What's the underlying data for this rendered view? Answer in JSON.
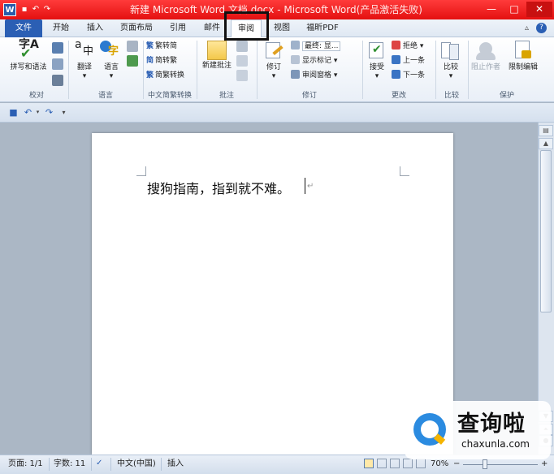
{
  "window": {
    "title": "新建 Microsoft Word 文档.docx  -  Microsoft Word(产品激活失败)",
    "app_icon_letter": "W",
    "controls": {
      "minimize": "—",
      "maximize": "□",
      "close": "✕"
    }
  },
  "ribbon_tabs": [
    "文件",
    "开始",
    "插入",
    "页面布局",
    "引用",
    "邮件",
    "审阅",
    "视图",
    "福昕PDF"
  ],
  "active_tab": "审阅",
  "ribbon": {
    "proofing": {
      "label": "校对",
      "spell_top": "字A",
      "spell": "拼写和语法"
    },
    "language": {
      "label": "语言",
      "translate": "翻译",
      "language": "语言",
      "arrow": "▾"
    },
    "chinese_conversion": {
      "label": "中文简繁转换",
      "to_simplified": "繁转简",
      "to_traditional": "简转繁",
      "convert": "简繁转换",
      "icon_fan": "繁",
      "icon_jian": "简",
      "icon_jian2": "繁"
    },
    "comments": {
      "label": "批注",
      "new_comment": "新建批注"
    },
    "tracking": {
      "label": "修订",
      "track_changes": "修订",
      "final_show": "最终: 显...",
      "show_markup": "显示标记 ▾",
      "review_pane": "审阅窗格 ▾",
      "arrow": "▾"
    },
    "changes": {
      "label": "更改",
      "accept": "接受",
      "reject": "拒绝 ▾",
      "previous": "上一条",
      "next": "下一条"
    },
    "compare": {
      "label": "比较",
      "compare": "比较"
    },
    "protect": {
      "label": "保护",
      "block_authors": "阻止作者",
      "restrict_editing": "限制编辑"
    }
  },
  "document": {
    "text": "搜狗指南，指到就不难。",
    "return_mark": "↵"
  },
  "status_bar": {
    "page": "页面: 1/1",
    "words": "字数: 11",
    "language": "中文(中国)",
    "mode": "插入",
    "zoom": "70%",
    "zoom_minus": "−",
    "zoom_plus": "+"
  },
  "watermark": {
    "cn": "查询啦",
    "en": "chaxunla.com"
  },
  "colors": {
    "titlebar": "#e41010",
    "file_tab": "#2b5fb4",
    "highlight_box": "#111111"
  }
}
